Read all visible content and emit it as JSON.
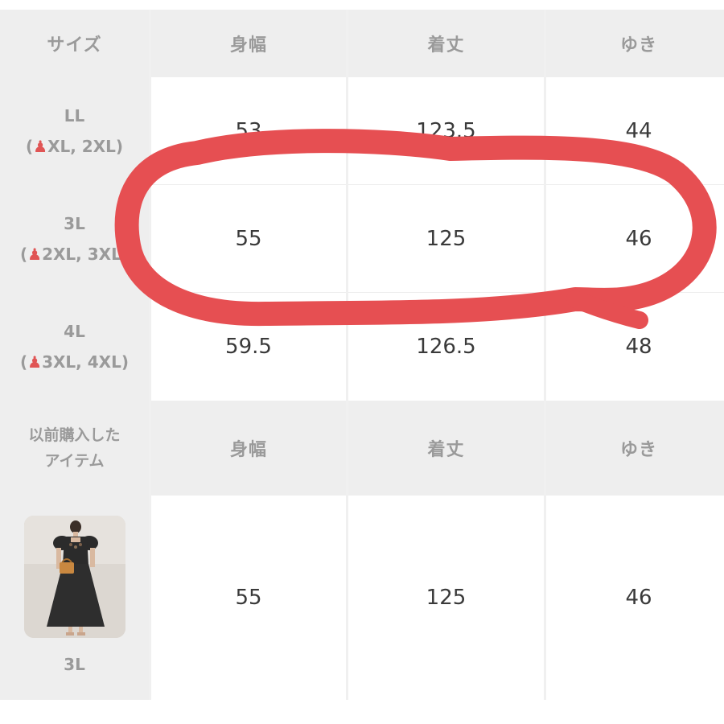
{
  "header": {
    "size": "サイズ",
    "col1": "身幅",
    "col2": "着丈",
    "col3": "ゆき"
  },
  "rows": [
    {
      "size": "LL",
      "fit": "XL, 2XL",
      "width": "53",
      "length": "123.5",
      "sleeve": "44"
    },
    {
      "size": "3L",
      "fit": "2XL, 3XL",
      "width": "55",
      "length": "125",
      "sleeve": "46"
    },
    {
      "size": "4L",
      "fit": "3XL, 4XL",
      "width": "59.5",
      "length": "126.5",
      "sleeve": "48"
    }
  ],
  "previous": {
    "label_line1": "以前購入した",
    "label_line2": "アイテム",
    "col1": "身幅",
    "col2": "着丈",
    "col3": "ゆき",
    "item_size": "3L",
    "width": "55",
    "length": "125",
    "sleeve": "46"
  },
  "icons": {
    "fit_icon": "person-icon"
  },
  "colors": {
    "annotation": "#e64f52",
    "fit_icon": "#e05555"
  }
}
